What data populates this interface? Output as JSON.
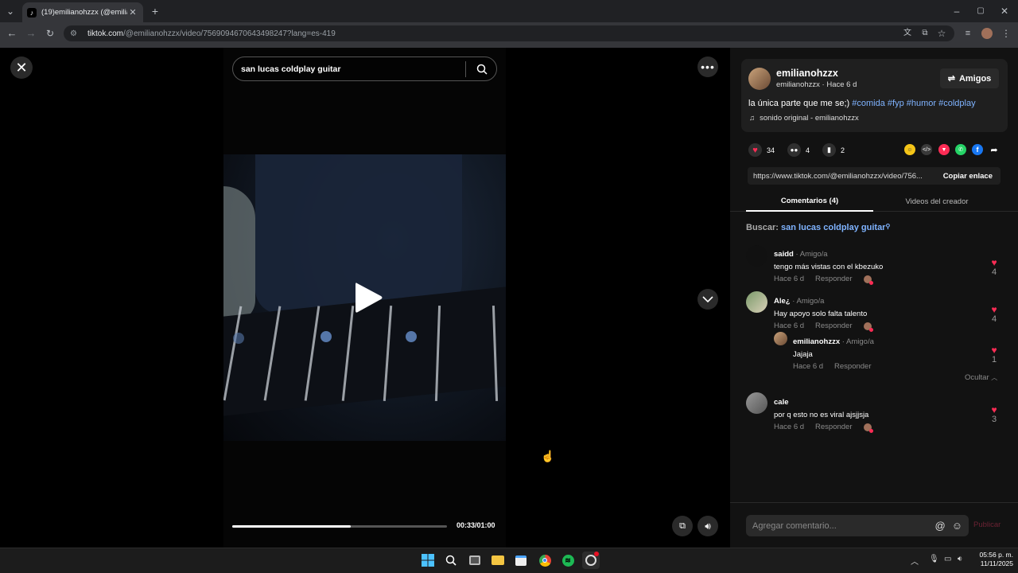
{
  "browser": {
    "tab_title": "(19)emilianohzzx (@emilianohz",
    "url_host": "tiktok.com",
    "url_rest": "/@emilianohzzx/video/7569094670643498247?lang=es-419"
  },
  "video": {
    "search_query": "san lucas coldplay guitar",
    "time": "00:33/01:00",
    "progress_fraction": 0.55
  },
  "author": {
    "name": "emilianohzzx",
    "subline": "emilianohzzx · Hace 6 d",
    "follow_label": "Amigos",
    "caption": "la única parte que me se;)",
    "hashtags": [
      "#comida",
      "#fyp",
      "#humor",
      "#coldplay"
    ],
    "sound": "sonido original - emilianohzzx"
  },
  "stats": {
    "likes": "34",
    "comments": "4",
    "saves": "2"
  },
  "link": {
    "url": "https://www.tiktok.com/@emilianohzzx/video/756...",
    "copy_label": "Copiar enlace"
  },
  "tabs": {
    "comments": "Comentarios (4)",
    "creator_videos": "Videos del creador"
  },
  "search_hint": {
    "label": "Buscar:",
    "query": "san lucas coldplay guitar"
  },
  "comments": [
    {
      "user": "saidd",
      "relation": " · Amigo/a",
      "text": "tengo más vistas con el kbezuko",
      "time": "Hace 6 d",
      "reply": "Responder",
      "likes": "4"
    },
    {
      "user": "Ale¿",
      "relation": " · Amigo/a",
      "text": "Hay apoyo solo falta talento",
      "time": "Hace 6 d",
      "reply": "Responder",
      "likes": "4"
    },
    {
      "user": "emilianohzzx",
      "relation": " · Amigo/a",
      "text": "Jajaja",
      "time": "Hace 6 d",
      "reply": "Responder",
      "likes": "1"
    },
    {
      "user": "cale",
      "relation": "",
      "text": "por q esto no es viral ajsjjsja",
      "time": "Hace 6 d",
      "reply": "Responder",
      "likes": "3"
    }
  ],
  "hide_label": "Ocultar",
  "composer": {
    "placeholder": "Agregar comentario...",
    "post_label": "Publicar"
  },
  "clock": {
    "time": "05:56 p. m.",
    "date": "11/11/2025"
  }
}
